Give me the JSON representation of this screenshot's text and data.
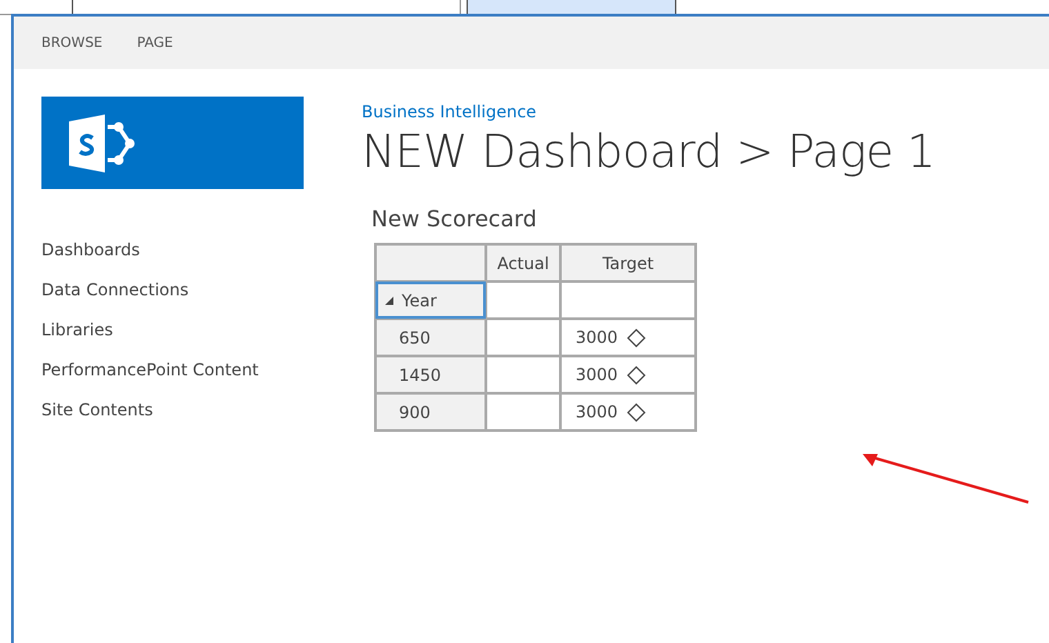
{
  "ribbon": {
    "tabs": [
      {
        "label": "BROWSE"
      },
      {
        "label": "PAGE"
      }
    ]
  },
  "site_title": "Business Intelligence",
  "page_title": "NEW Dashboard > Page 1",
  "nav": {
    "items": [
      {
        "label": "Dashboards"
      },
      {
        "label": "Data Connections"
      },
      {
        "label": "Libraries"
      },
      {
        "label": "PerformancePoint Content"
      },
      {
        "label": "Site Contents"
      }
    ]
  },
  "scorecard": {
    "title": "New Scorecard",
    "columns": [
      "Actual",
      "Target"
    ],
    "row_header": {
      "label": "Year",
      "expanded": true,
      "selected": true
    },
    "rows": [
      {
        "label": "650",
        "target": "3000"
      },
      {
        "label": "1450",
        "target": "3000"
      },
      {
        "label": "900",
        "target": "3000"
      }
    ]
  }
}
